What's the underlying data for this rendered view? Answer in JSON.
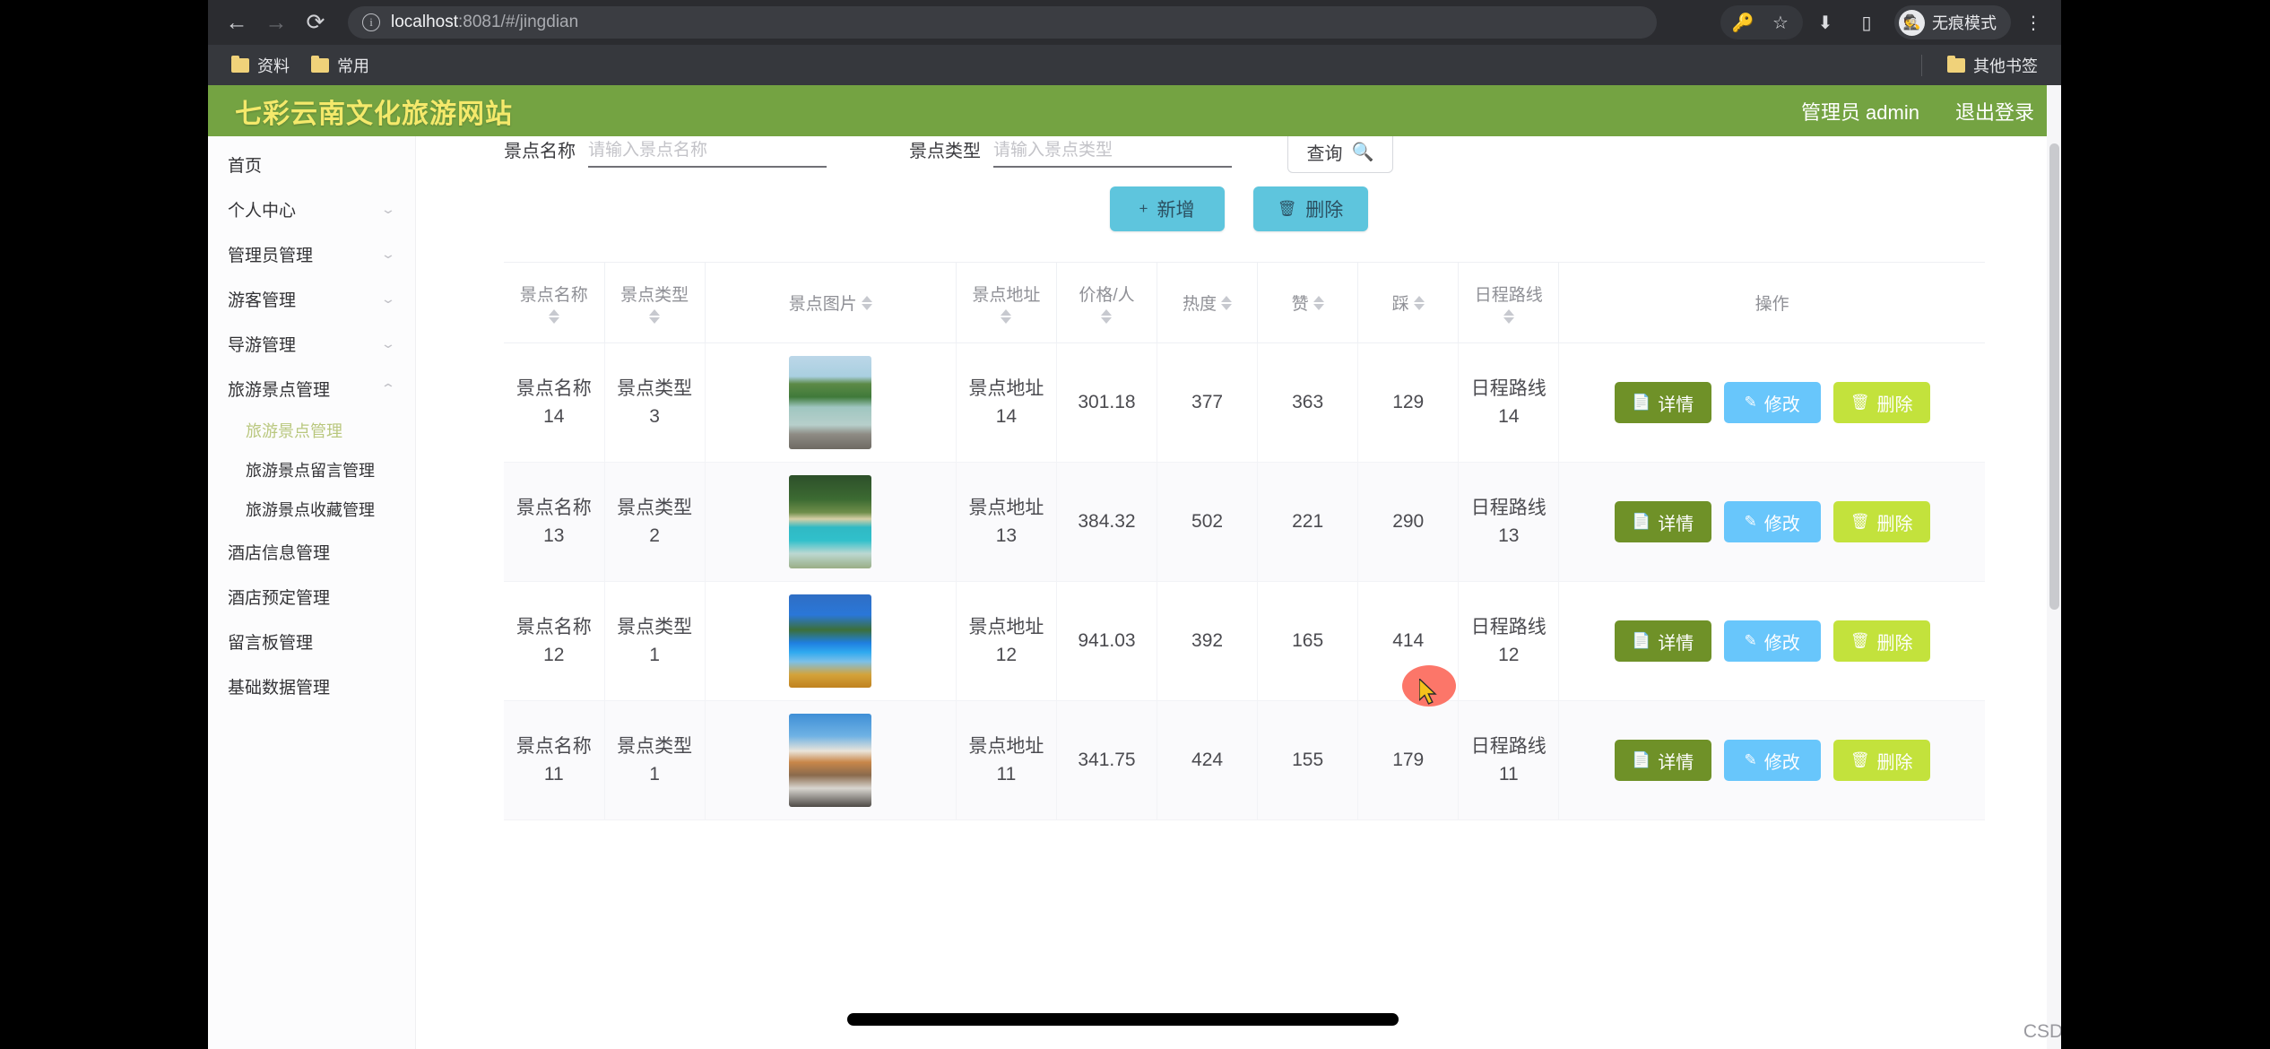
{
  "browser": {
    "back_icon": "back-arrow-icon",
    "forward_icon": "forward-arrow-icon",
    "reload_icon": "reload-icon",
    "site_info_icon": "info-circle-icon",
    "url_host": "localhost",
    "url_path": ":8081/#/jingdian",
    "url_full": "localhost:8081/#/jingdian",
    "right_icons": [
      "password-key-icon",
      "bookmark-star-icon",
      "download-icon",
      "side-panel-icon"
    ],
    "incognito_label": "无痕模式",
    "incognito_icon": "incognito-hat-icon",
    "menu_icon": "three-dot-menu-icon",
    "bookmarks": [
      {
        "label": "资料",
        "icon": "folder-icon"
      },
      {
        "label": "常用",
        "icon": "folder-icon"
      }
    ],
    "other_bookmarks": {
      "label": "其他书签",
      "icon": "folder-icon"
    }
  },
  "app": {
    "brand": "七彩云南文化旅游网站",
    "header_user": "管理员 admin",
    "header_logout": "退出登录",
    "brand_color": "#f4e96b",
    "header_bg": "#74a342"
  },
  "sidebar": {
    "items": [
      {
        "label": "首页",
        "has_arrow": false,
        "arrow": "",
        "level": 1,
        "active": false
      },
      {
        "label": "个人中心",
        "has_arrow": true,
        "arrow": "chevron-down-icon",
        "level": 1,
        "active": false
      },
      {
        "label": "管理员管理",
        "has_arrow": true,
        "arrow": "chevron-down-icon",
        "level": 1,
        "active": false
      },
      {
        "label": "游客管理",
        "has_arrow": true,
        "arrow": "chevron-down-icon",
        "level": 1,
        "active": false
      },
      {
        "label": "导游管理",
        "has_arrow": true,
        "arrow": "chevron-down-icon",
        "level": 1,
        "active": false
      },
      {
        "label": "旅游景点管理",
        "has_arrow": true,
        "arrow": "chevron-up-icon",
        "level": 1,
        "active": false
      },
      {
        "label": "旅游景点管理",
        "has_arrow": false,
        "arrow": "",
        "level": 2,
        "active": true
      },
      {
        "label": "旅游景点留言管理",
        "has_arrow": false,
        "arrow": "",
        "level": 2,
        "active": false
      },
      {
        "label": "旅游景点收藏管理",
        "has_arrow": false,
        "arrow": "",
        "level": 2,
        "active": false
      },
      {
        "label": "酒店信息管理",
        "has_arrow": false,
        "arrow": "",
        "level": 1,
        "active": false
      },
      {
        "label": "酒店预定管理",
        "has_arrow": false,
        "arrow": "",
        "level": 1,
        "active": false
      },
      {
        "label": "留言板管理",
        "has_arrow": false,
        "arrow": "",
        "level": 1,
        "active": false
      },
      {
        "label": "基础数据管理",
        "has_arrow": false,
        "arrow": "",
        "level": 1,
        "active": false
      }
    ]
  },
  "search": {
    "name_label": "景点名称",
    "name_placeholder": "请输入景点名称",
    "name_value": "",
    "type_label": "景点类型",
    "type_placeholder": "请输入景点类型",
    "type_value": "",
    "button_label": "查询",
    "button_icon": "search-icon"
  },
  "toolbar": {
    "add_label": "新增",
    "add_icon": "plus-icon",
    "delete_label": "删除",
    "delete_icon": "trash-icon"
  },
  "table": {
    "columns": [
      {
        "label": "景点名称",
        "sortable": true,
        "layout": "stack"
      },
      {
        "label": "景点类型",
        "sortable": true,
        "layout": "stack"
      },
      {
        "label": "景点图片",
        "sortable": true,
        "layout": "inline"
      },
      {
        "label": "景点地址",
        "sortable": true,
        "layout": "stack"
      },
      {
        "label": "价格/人",
        "sortable": true,
        "layout": "stack"
      },
      {
        "label": "热度",
        "sortable": true,
        "layout": "inline"
      },
      {
        "label": "赞",
        "sortable": true,
        "layout": "inline"
      },
      {
        "label": "踩",
        "sortable": true,
        "layout": "inline"
      },
      {
        "label": "日程路线",
        "sortable": true,
        "layout": "stack"
      },
      {
        "label": "操作",
        "sortable": false,
        "layout": "inline"
      }
    ],
    "rows": [
      {
        "name": "景点名称\n14",
        "type": "景点类型\n3",
        "image": "lake-pier-willow-photo",
        "address": "景点地址\n14",
        "price": "301.18",
        "heat": "377",
        "likes": "363",
        "dislikes": "129",
        "route": "日程路线\n14"
      },
      {
        "name": "景点名称\n13",
        "type": "景点类型\n2",
        "image": "turquoise-lake-forest-photo",
        "address": "景点地址\n13",
        "price": "384.32",
        "heat": "502",
        "likes": "221",
        "dislikes": "290",
        "route": "日程路线\n13"
      },
      {
        "name": "景点名称\n12",
        "type": "景点类型\n1",
        "image": "blue-lake-autumn-photo",
        "address": "景点地址\n12",
        "price": "941.03",
        "heat": "392",
        "likes": "165",
        "dislikes": "414",
        "route": "日程路线\n12"
      },
      {
        "name": "景点名称\n11",
        "type": "景点类型\n1",
        "image": "snow-mountain-peak-photo",
        "address": "景点地址\n11",
        "price": "341.75",
        "heat": "424",
        "likes": "155",
        "dislikes": "179",
        "route": "日程路线\n11"
      }
    ],
    "row_actions": {
      "detail_label": "详情",
      "detail_icon": "document-icon",
      "detail_color": "#6f9128",
      "edit_label": "修改",
      "edit_icon": "pencil-icon",
      "edit_color": "#68c6fb",
      "delete_label": "删除",
      "delete_icon": "trash-icon",
      "delete_color": "#c3e23c"
    }
  },
  "watermark": "CSDN @落霞与孤鹜齐飞。。"
}
